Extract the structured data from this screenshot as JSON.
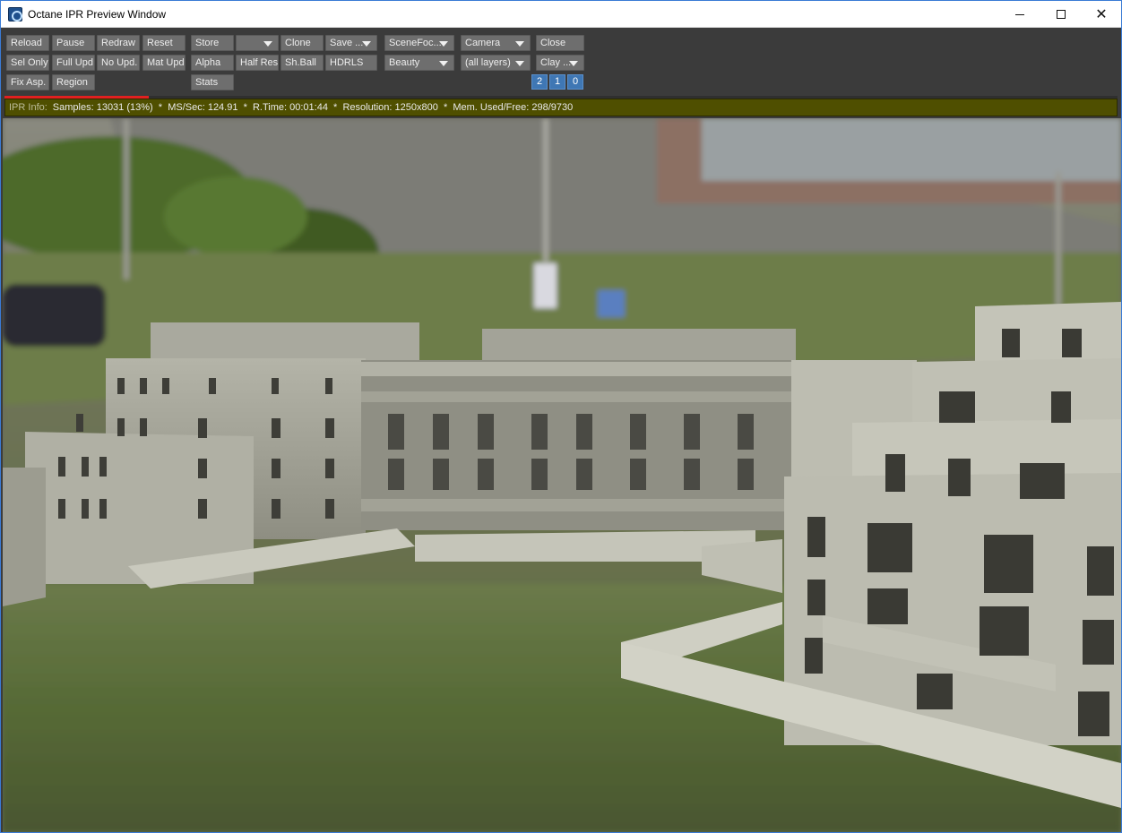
{
  "window": {
    "title": "Octane IPR Preview Window"
  },
  "toolbar": {
    "row1": {
      "reload": "Reload",
      "pause": "Pause",
      "redraw": "Redraw",
      "reset": "Reset",
      "store": "Store",
      "store_slot": "",
      "clone": "Clone",
      "save": "Save ...",
      "scene_focus": "SceneFoc...",
      "camera": "Camera",
      "close": "Close"
    },
    "row2": {
      "sel_only": "Sel Only",
      "full_upd": "Full Upd.",
      "no_upd": "No Upd.",
      "mat_upd": "Mat Upd",
      "alpha": "Alpha",
      "half_res": "Half Res",
      "sh_ball": "Sh.Ball",
      "hdrls": "HDRLS",
      "beauty": "Beauty",
      "layers": "(all layers)",
      "clay": "Clay ..."
    },
    "row3": {
      "fix_asp": "Fix Asp.",
      "region": "Region",
      "stats": "Stats",
      "num_2": "2",
      "num_1": "1",
      "num_0": "0"
    }
  },
  "render_progress": 0.13,
  "info": {
    "label": "IPR Info:",
    "text": "Samples: 13031 (13%)  *  MS/Sec: 124.91  *  R.Time: 00:01:44  *  Resolution: 1250x800  *  Mem. Used/Free: 298/9730"
  },
  "colors": {
    "toolbar_bg": "#3b3b3b",
    "button_bg": "#6e6e6e",
    "info_bg": "#4f4f00",
    "progress": "#e02020",
    "num_button": "#3f77b4"
  },
  "icons": {
    "app": "octane-app-icon",
    "minimize": "minimize-icon",
    "maximize": "maximize-icon",
    "close": "close-icon",
    "dropdown": "chevron-down-icon"
  }
}
